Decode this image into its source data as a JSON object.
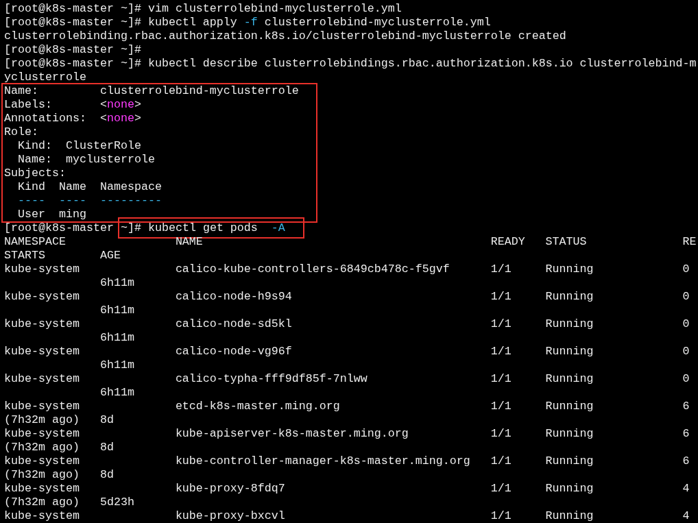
{
  "session": [
    {
      "prompt": "[root@k8s-master ~]#",
      "parts": [
        {
          "text": "vim clusterrolebind-myclusterrole.yml",
          "kind": "plain"
        }
      ]
    },
    {
      "prompt": "[root@k8s-master ~]#",
      "parts": [
        {
          "text": "kubectl apply",
          "kind": "plain"
        },
        {
          "text": "-f",
          "kind": "flag"
        },
        {
          "text": "clusterrolebind-myclusterrole.yml",
          "kind": "plain"
        }
      ]
    },
    {
      "output": "clusterrolebinding.rbac.authorization.k8s.io/clusterrolebind-myclusterrole created"
    },
    {
      "prompt": "[root@k8s-master ~]#"
    },
    {
      "prompt": "[root@k8s-master ~]#",
      "parts": [
        {
          "text": "kubectl describe clusterrolebindings.rbac.authorization.k8s.io clusterrolebind-m",
          "kind": "plain"
        }
      ]
    },
    {
      "output": "yclusterrole"
    }
  ],
  "describe": {
    "highlighted": true,
    "fields": [
      {
        "key": "Name:",
        "value": [
          {
            "text": "clusterrolebind-myclusterrole",
            "kind": "plain"
          }
        ]
      },
      {
        "key": "Labels:",
        "value": [
          {
            "text": "<",
            "kind": "plain"
          },
          {
            "text": "none",
            "kind": "keyword"
          },
          {
            "text": ">",
            "kind": "plain"
          }
        ]
      },
      {
        "key": "Annotations:",
        "value": [
          {
            "text": "<",
            "kind": "plain"
          },
          {
            "text": "none",
            "kind": "keyword"
          },
          {
            "text": ">",
            "kind": "plain"
          }
        ]
      }
    ],
    "role": {
      "label": "Role:",
      "fields": [
        {
          "key": "Kind:",
          "value": "ClusterRole"
        },
        {
          "key": "Name:",
          "value": "myclusterrole"
        }
      ]
    },
    "subjects": {
      "label": "Subjects:",
      "columns": [
        "Kind",
        "Name",
        "Namespace"
      ],
      "rules": [
        "----",
        "----",
        "---------"
      ],
      "rows": [
        [
          "User",
          "ming"
        ]
      ]
    }
  },
  "get_pods": {
    "prompt_host": "[root@k8s-master",
    "prompt_dir": "~]#",
    "command": "kubectl get pods",
    "flag": "-A",
    "highlighted": true
  },
  "pods_table": {
    "columns": [
      "NAMESPACE",
      "NAME",
      "READY",
      "STATUS",
      "RE"
    ],
    "wrapped_columns": [
      "STARTS",
      "AGE"
    ],
    "rows": [
      {
        "namespace": "kube-system",
        "name": "calico-kube-controllers-6849cb478c-f5gvf",
        "ready": "1/1",
        "status": "Running",
        "restarts": "0",
        "age": "6h11m"
      },
      {
        "namespace": "kube-system",
        "name": "calico-node-h9s94",
        "ready": "1/1",
        "status": "Running",
        "restarts": "0",
        "age": "6h11m"
      },
      {
        "namespace": "kube-system",
        "name": "calico-node-sd5kl",
        "ready": "1/1",
        "status": "Running",
        "restarts": "0",
        "age": "6h11m"
      },
      {
        "namespace": "kube-system",
        "name": "calico-node-vg96f",
        "ready": "1/1",
        "status": "Running",
        "restarts": "0",
        "age": "6h11m"
      },
      {
        "namespace": "kube-system",
        "name": "calico-typha-fff9df85f-7nlww",
        "ready": "1/1",
        "status": "Running",
        "restarts": "0",
        "age": "6h11m"
      },
      {
        "namespace": "kube-system",
        "name": "etcd-k8s-master.ming.org",
        "ready": "1/1",
        "status": "Running",
        "restarts": "6",
        "restart_note": "(7h32m ago)",
        "age": "8d"
      },
      {
        "namespace": "kube-system",
        "name": "kube-apiserver-k8s-master.ming.org",
        "ready": "1/1",
        "status": "Running",
        "restarts": "6",
        "restart_note": "(7h32m ago)",
        "age": "8d"
      },
      {
        "namespace": "kube-system",
        "name": "kube-controller-manager-k8s-master.ming.org",
        "ready": "1/1",
        "status": "Running",
        "restarts": "6",
        "restart_note": "(7h32m ago)",
        "age": "8d"
      },
      {
        "namespace": "kube-system",
        "name": "kube-proxy-8fdq7",
        "ready": "1/1",
        "status": "Running",
        "restarts": "4",
        "restart_note": "(7h32m ago)",
        "age": "5d23h"
      },
      {
        "namespace": "kube-system",
        "name": "kube-proxy-bxcvl",
        "ready": "1/1",
        "status": "Running",
        "restarts": "4"
      }
    ]
  }
}
